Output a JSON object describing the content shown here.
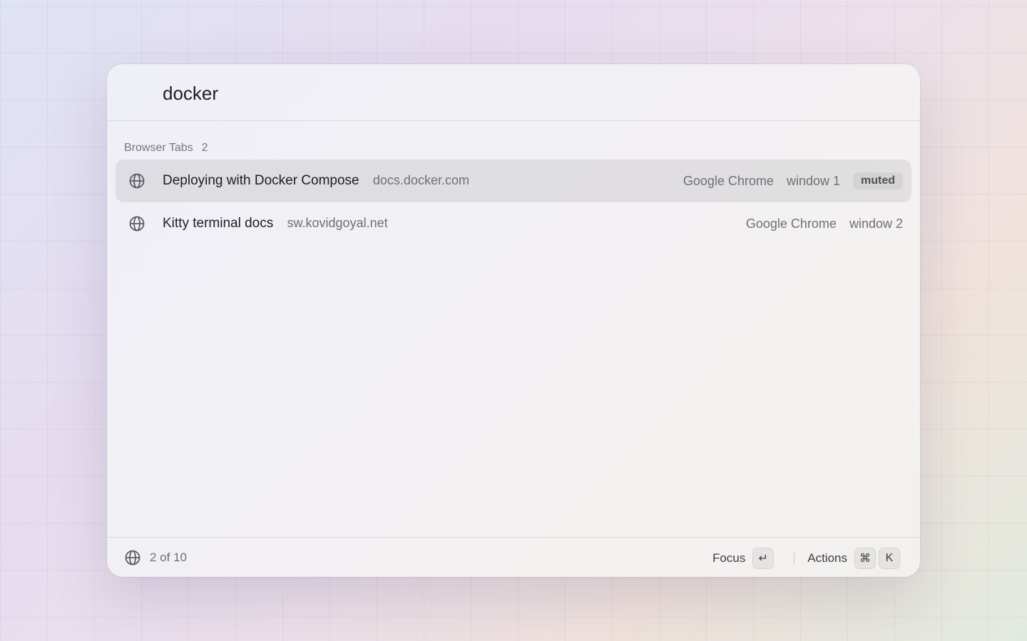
{
  "search": {
    "query": "docker",
    "placeholder": ""
  },
  "section": {
    "title": "Browser Tabs",
    "count": "2"
  },
  "results": [
    {
      "icon": "globe-icon",
      "title": "Deploying with Docker Compose",
      "url": "docs.docker.com",
      "app": "Google Chrome",
      "window": "window 1",
      "badge": "muted",
      "selected": true
    },
    {
      "icon": "globe-icon",
      "title": "Kitty terminal docs",
      "url": "sw.kovidgoyal.net",
      "app": "Google Chrome",
      "window": "window 2",
      "selected": false
    }
  ],
  "footer": {
    "icon": "globe-icon",
    "position": "2 of 10",
    "primary_action": "Focus",
    "primary_key": "↵",
    "secondary_action": "Actions",
    "secondary_keys": [
      "⌘",
      "K"
    ]
  }
}
